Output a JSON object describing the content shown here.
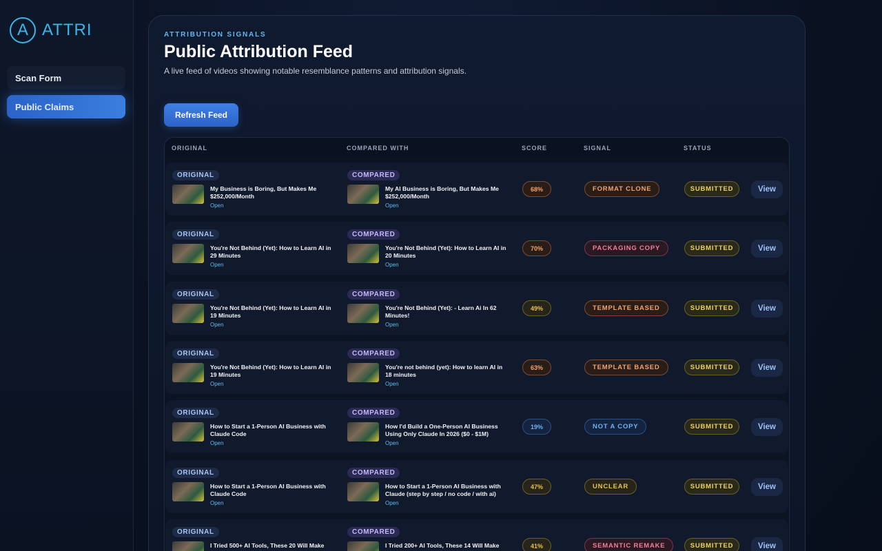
{
  "brand": {
    "logo_letter": "A",
    "name": "ATTRI"
  },
  "nav": {
    "scan_form": "Scan Form",
    "public_claims": "Public Claims"
  },
  "header": {
    "eyebrow": "ATTRIBUTION SIGNALS",
    "title": "Public Attribution Feed",
    "subtitle": "A live feed of videos showing notable resemblance patterns and attribution signals."
  },
  "refresh_label": "Refresh Feed",
  "columns": {
    "original": "ORIGINAL",
    "compared": "COMPARED WITH",
    "score": "SCORE",
    "signal": "SIGNAL",
    "status": "STATUS"
  },
  "tag_original": "ORIGINAL",
  "tag_compared": "COMPARED",
  "open_label": "Open",
  "view_label": "View",
  "colors": {
    "accent": "#3bb6e8",
    "primary_button": "#3a7ee0",
    "status_yellow": "#f0d35a"
  },
  "rows": [
    {
      "original": "My Business is Boring, But Makes Me $252,000/Month",
      "compared": "My AI Business is Boring, But Makes Me $252,000/Month",
      "score": "68%",
      "signal": "FORMAT CLONE",
      "status": "SUBMITTED"
    },
    {
      "original": "You're Not Behind (Yet): How to Learn AI in 29 Minutes",
      "compared": "You're Not Behind (Yet): How to Learn AI in 20 Minutes",
      "score": "70%",
      "signal": "PACKAGING COPY",
      "status": "SUBMITTED"
    },
    {
      "original": "You're Not Behind (Yet): How to Learn AI in 19 Minutes",
      "compared": "You're Not Behind (Yet): - Learn Ai In 62 Minutes!",
      "score": "49%",
      "signal": "TEMPLATE BASED",
      "status": "SUBMITTED"
    },
    {
      "original": "You're Not Behind (Yet): How to Learn AI in 19 Minutes",
      "compared": "You're not behind (yet): How to learn AI in 18 minutes",
      "score": "63%",
      "signal": "TEMPLATE BASED",
      "status": "SUBMITTED"
    },
    {
      "original": "How to Start a 1-Person AI Business with Claude Code",
      "compared": "How I'd Build a One-Person AI Business Using Only Claude In 2026 ($0 - $1M)",
      "score": "19%",
      "signal": "NOT A COPY",
      "status": "SUBMITTED"
    },
    {
      "original": "How to Start a 1-Person AI Business with Claude Code",
      "compared": "How to Start a 1-Person AI Business with Claude (step by step / no code / with ai)",
      "score": "47%",
      "signal": "UNCLEAR",
      "status": "SUBMITTED"
    },
    {
      "original": "I Tried 500+ AI Tools, These 20 Will Make",
      "compared": "I Tried 200+ AI Tools, These 14 Will Make",
      "score": "41%",
      "signal": "SEMANTIC REMAKE",
      "status": "SUBMITTED"
    }
  ]
}
